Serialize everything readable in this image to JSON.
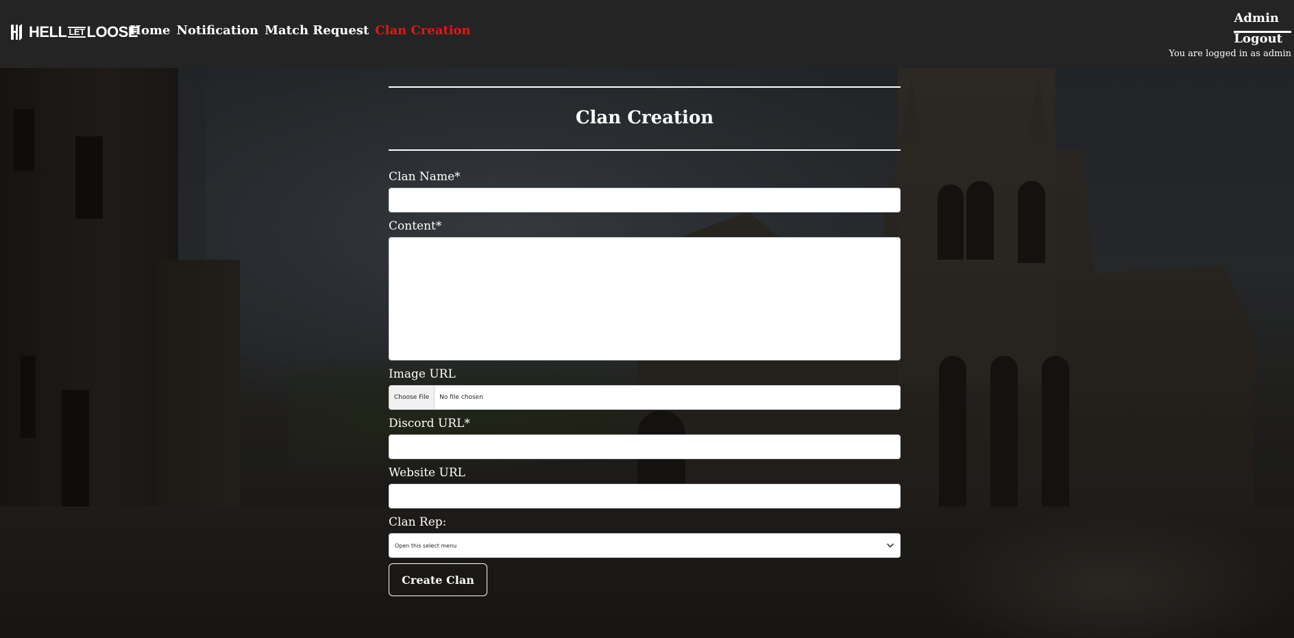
{
  "navbar": {
    "brand": {
      "part1": "HELL",
      "part2": "LET",
      "part3": "LOOSE"
    },
    "links": [
      {
        "label": "Home"
      },
      {
        "label": "Notification"
      },
      {
        "label": "Match Request"
      },
      {
        "label": "Clan Creation",
        "active": true
      }
    ],
    "admin_label": "Admin",
    "logout_label": "Logout",
    "logged_in_text": "You are logged in as admin"
  },
  "form": {
    "title": "Clan Creation",
    "clan_name_label": "Clan Name*",
    "clan_name_value": "",
    "content_label": "Content*",
    "content_value": "",
    "image_label": "Image URL",
    "file_button": "Choose File",
    "file_status": "No file chosen",
    "discord_label": "Discord URL*",
    "discord_value": "",
    "website_label": "Website URL",
    "website_value": "",
    "rep_label": "Clan Rep:",
    "rep_selected": "Open this select menu",
    "submit_label": "Create Clan"
  },
  "colors": {
    "navbar_bg": "#242424",
    "active_link": "#e21818",
    "text": "#ffffff"
  },
  "icons": {
    "brand": "hell-let-loose-logo-icon",
    "select": "chevron-down-icon"
  }
}
